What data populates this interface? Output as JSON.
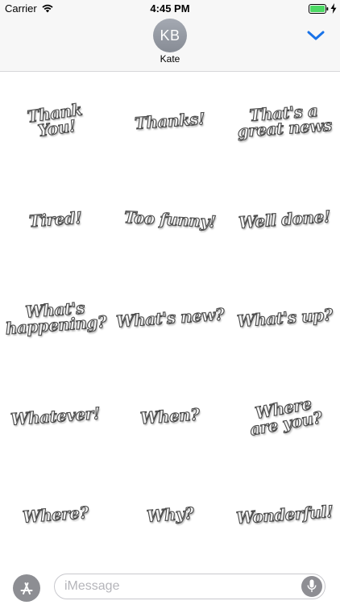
{
  "status_bar": {
    "carrier": "Carrier",
    "time": "4:45 PM",
    "battery_color": "#4cd964"
  },
  "header": {
    "avatar_initials": "KB",
    "contact_name": "Kate",
    "accent_color": "#1a73e8"
  },
  "stickers": [
    "Thank\nYou!",
    "Thanks!",
    "That's a\ngreat news",
    "Tired!",
    "Too funny!",
    "Well done!",
    "What's\nhappening?",
    "What's new?",
    "What's up?",
    "Whatever!",
    "When?",
    "Where\nare you?",
    "Where?",
    "Why?",
    "Wonderful!"
  ],
  "input_bar": {
    "placeholder": "iMessage",
    "app_icon": "app-store-icon",
    "mic_icon": "mic-icon"
  }
}
